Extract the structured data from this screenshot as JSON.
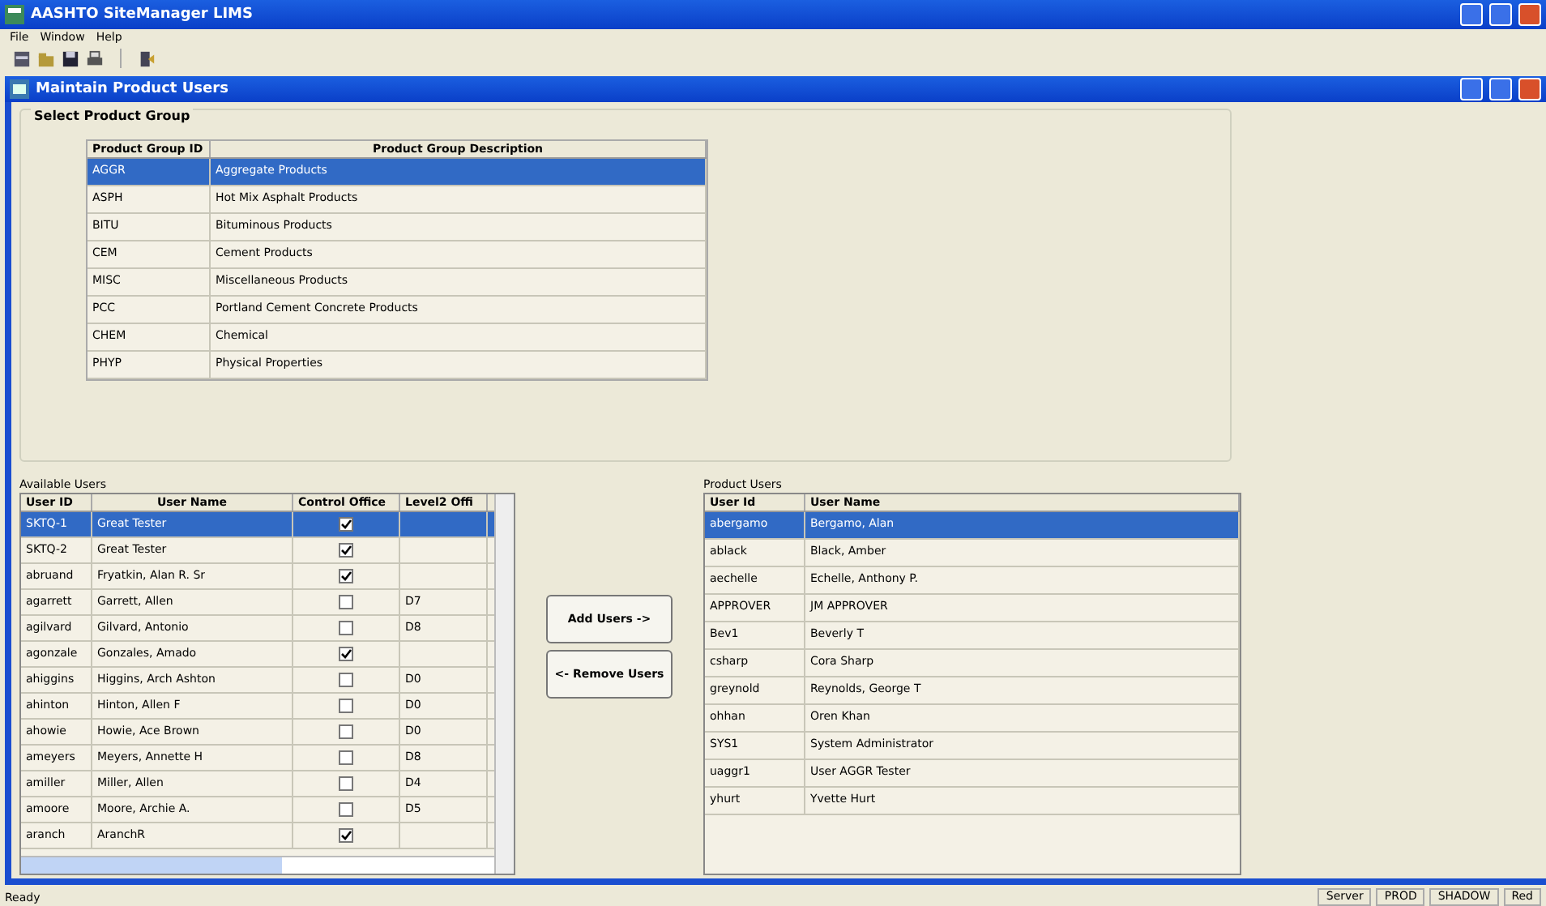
{
  "window": {
    "title": "AASHTO SiteManager LIMS"
  },
  "menu": [
    "File",
    "Window",
    "Help"
  ],
  "child_window": {
    "title": "Maintain Product Users"
  },
  "product_group": {
    "label": "Select Product Group",
    "columns": [
      "Product Group ID",
      "Product Group Description"
    ],
    "rows": [
      {
        "id": "AGGR",
        "description": "Aggregate Products",
        "selected": true
      },
      {
        "id": "ASPH",
        "description": "Hot Mix Asphalt Products",
        "selected": false
      },
      {
        "id": "BITU",
        "description": "Bituminous Products",
        "selected": false
      },
      {
        "id": "CEM",
        "description": "Cement Products",
        "selected": false
      },
      {
        "id": "MISC",
        "description": "Miscellaneous Products",
        "selected": false
      },
      {
        "id": "PCC",
        "description": "Portland Cement Concrete Products",
        "selected": false
      },
      {
        "id": "CHEM",
        "description": "Chemical",
        "selected": false
      },
      {
        "id": "PHYP",
        "description": "Physical Properties",
        "selected": false
      }
    ]
  },
  "available_users": {
    "label": "Available Users",
    "columns": [
      "User ID",
      "User Name",
      "Control Office",
      "Level2 Offi"
    ],
    "rows": [
      {
        "id": "SKTQ-1",
        "name": "Great Tester",
        "control_office": true,
        "level2": "",
        "selected": true
      },
      {
        "id": "SKTQ-2",
        "name": "Great Tester",
        "control_office": true,
        "level2": "",
        "selected": false
      },
      {
        "id": "abruand",
        "name": "Fryatkin, Alan R. Sr",
        "control_office": true,
        "level2": "",
        "selected": false
      },
      {
        "id": "agarrett",
        "name": "Garrett, Allen",
        "control_office": false,
        "level2": "D7",
        "selected": false
      },
      {
        "id": "agilvard",
        "name": "Gilvard, Antonio",
        "control_office": false,
        "level2": "D8",
        "selected": false
      },
      {
        "id": "agonzale",
        "name": "Gonzales, Amado",
        "control_office": true,
        "level2": "",
        "selected": false
      },
      {
        "id": "ahiggins",
        "name": "Higgins, Arch Ashton",
        "control_office": false,
        "level2": "D0",
        "selected": false
      },
      {
        "id": "ahinton",
        "name": "Hinton, Allen F",
        "control_office": false,
        "level2": "D0",
        "selected": false
      },
      {
        "id": "ahowie",
        "name": "Howie, Ace Brown",
        "control_office": false,
        "level2": "D0",
        "selected": false
      },
      {
        "id": "ameyers",
        "name": "Meyers, Annette H",
        "control_office": false,
        "level2": "D8",
        "selected": false
      },
      {
        "id": "amiller",
        "name": "Miller, Allen",
        "control_office": false,
        "level2": "D4",
        "selected": false
      },
      {
        "id": "amoore",
        "name": "Moore, Archie A.",
        "control_office": false,
        "level2": "D5",
        "selected": false
      },
      {
        "id": "aranch",
        "name": "AranchR",
        "control_office": true,
        "level2": "",
        "selected": false
      }
    ]
  },
  "buttons": [
    "Add Users ->",
    "<- Remove Users"
  ],
  "product_users": {
    "label": "Product Users",
    "columns": [
      "User Id",
      "User Name"
    ],
    "rows": [
      {
        "id": "abergamo",
        "name": "Bergamo, Alan",
        "selected": true
      },
      {
        "id": "ablack",
        "name": "Black, Amber",
        "selected": false
      },
      {
        "id": "aechelle",
        "name": "Echelle, Anthony P.",
        "selected": false
      },
      {
        "id": "APPROVER",
        "name": "JM APPROVER",
        "selected": false
      },
      {
        "id": "Bev1",
        "name": "Beverly T",
        "selected": false
      },
      {
        "id": "csharp",
        "name": "Cora Sharp",
        "selected": false
      },
      {
        "id": "greynold",
        "name": "Reynolds, George T",
        "selected": false
      },
      {
        "id": "ohhan",
        "name": "Oren Khan",
        "selected": false
      },
      {
        "id": "SYS1",
        "name": "System Administrator",
        "selected": false
      },
      {
        "id": "uaggr1",
        "name": "User AGGR Tester",
        "selected": false
      },
      {
        "id": "yhurt",
        "name": "Yvette Hurt",
        "selected": false
      }
    ]
  },
  "status_bar": {
    "message": "Ready",
    "panels": [
      "Server",
      "PROD",
      "SHADOW",
      "Red"
    ]
  }
}
